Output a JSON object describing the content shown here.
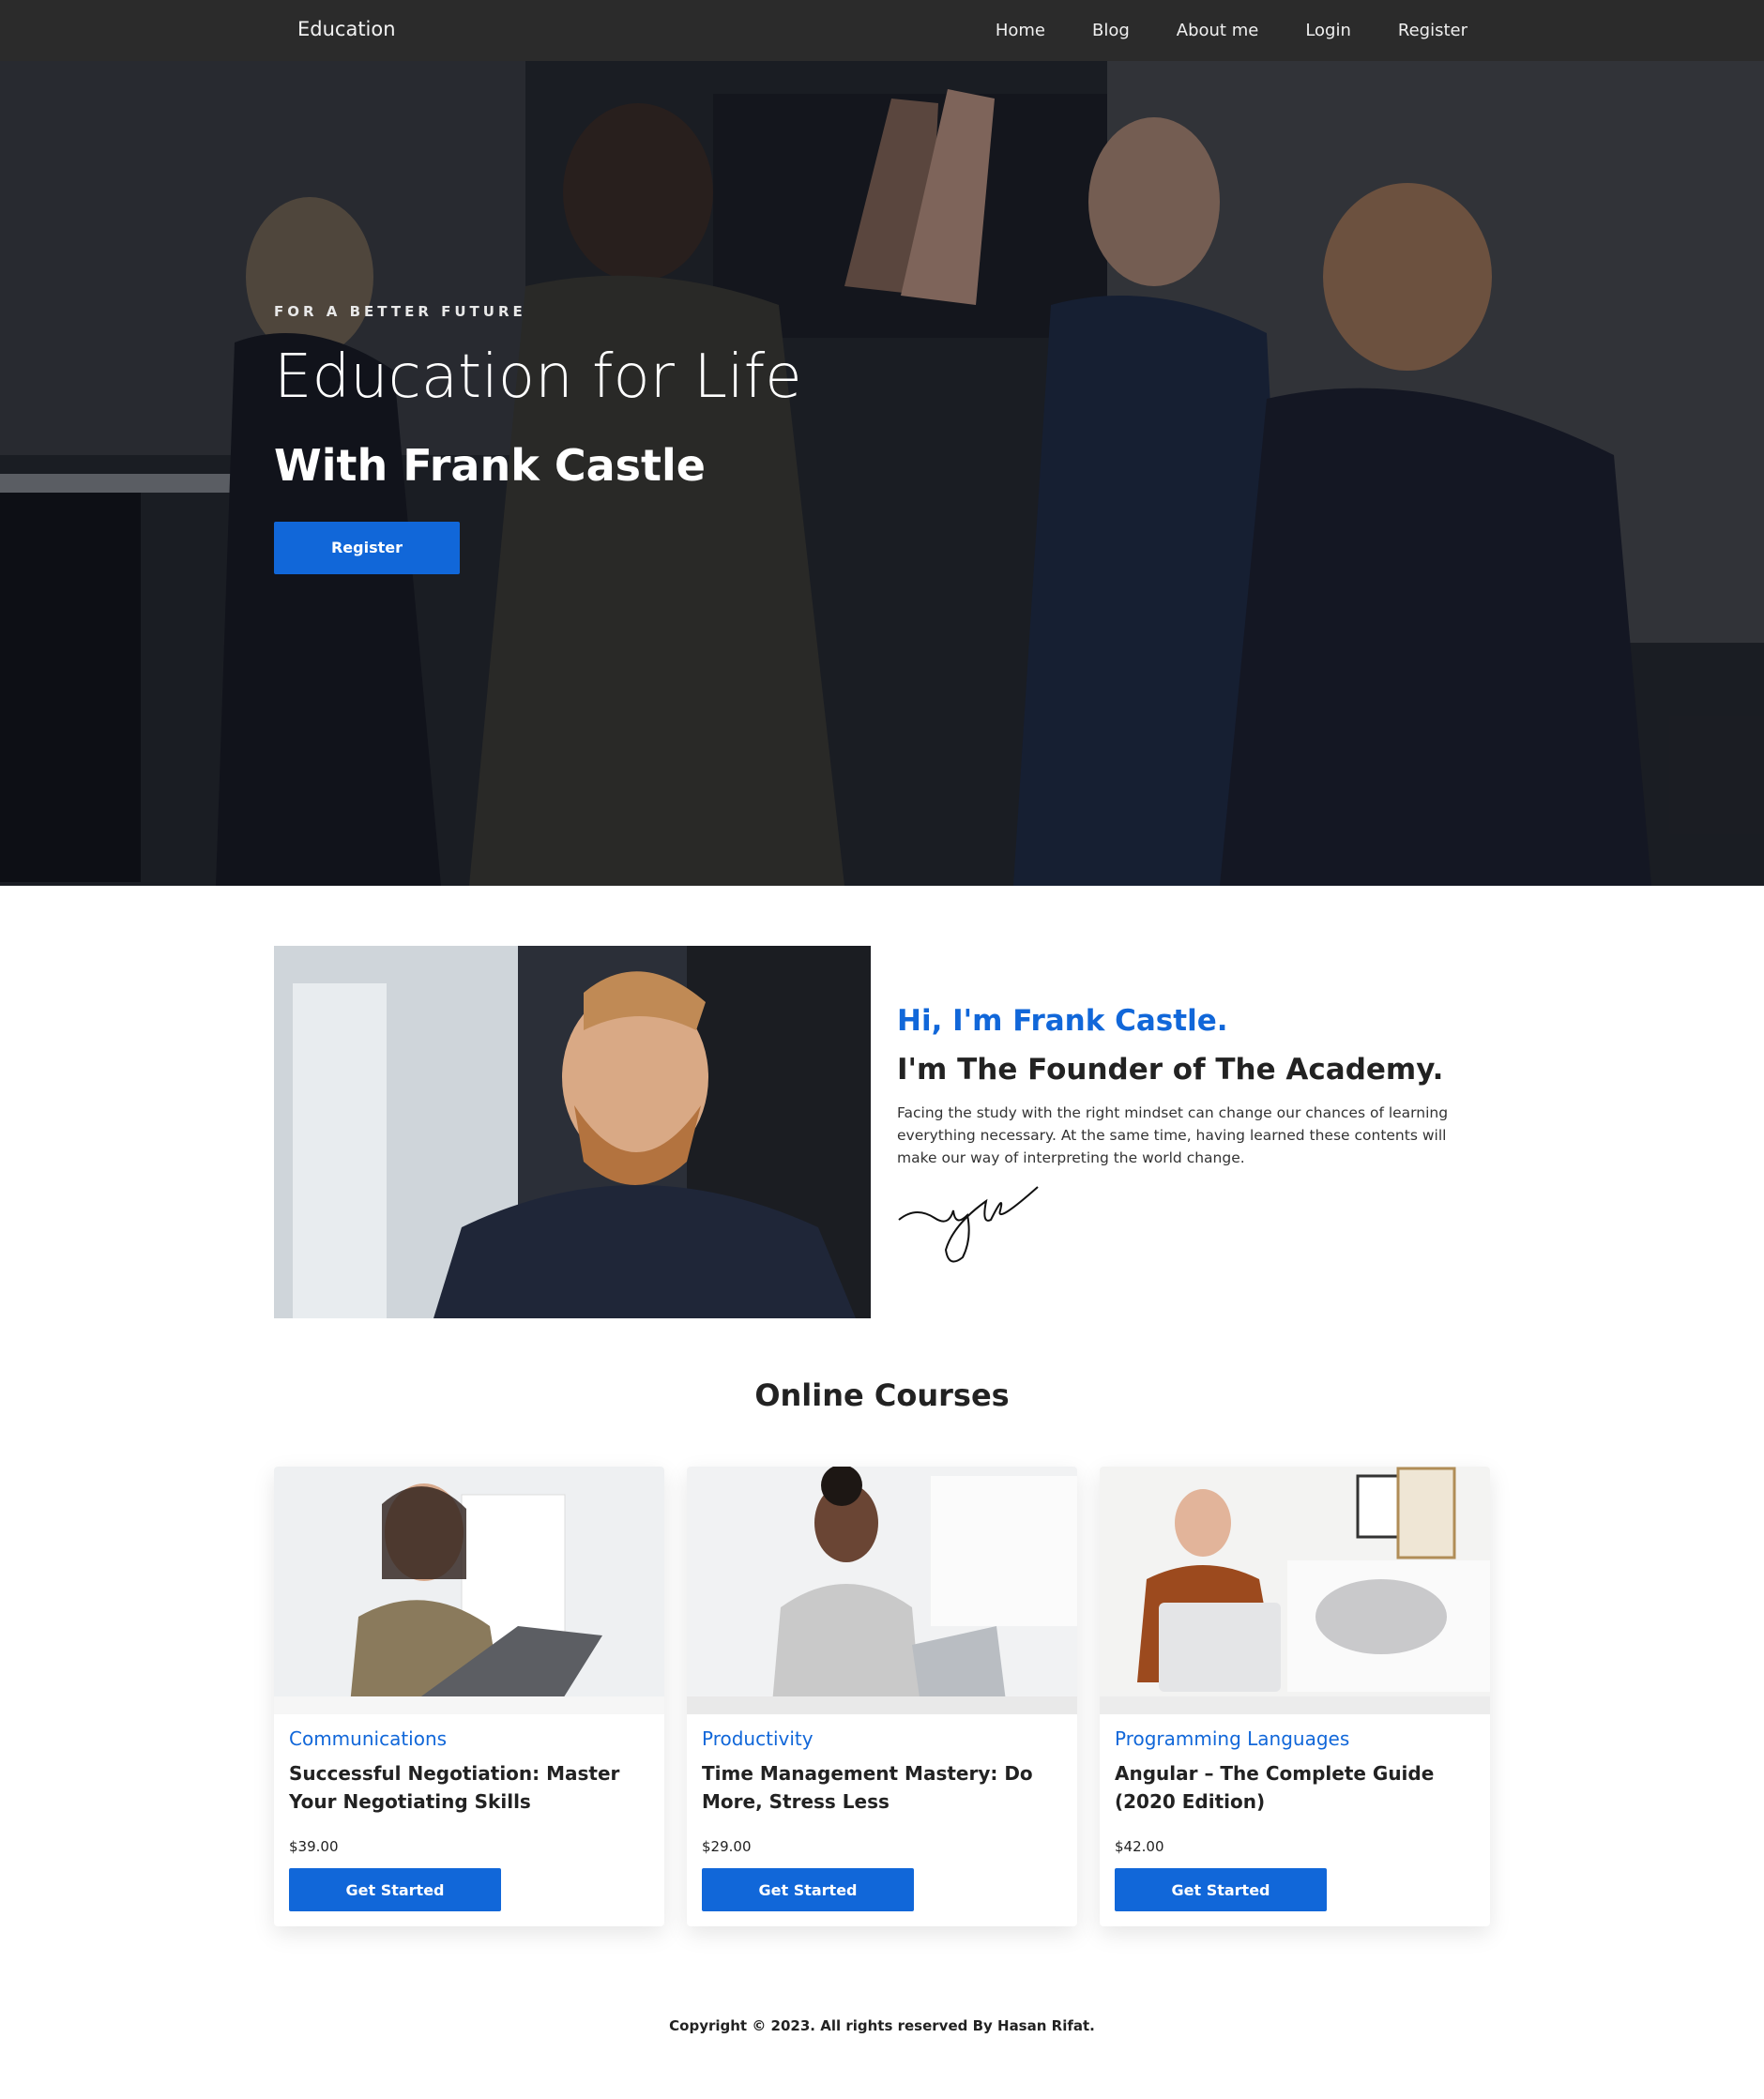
{
  "nav": {
    "brand": "Education",
    "links": [
      "Home",
      "Blog",
      "About me",
      "Login",
      "Register"
    ]
  },
  "hero": {
    "eyebrow": "FOR A BETTER FUTURE",
    "title": "Education for Life",
    "subtitle": "With Frank Castle",
    "button": "Register"
  },
  "about": {
    "greeting": "Hi, I'm Frank Castle.",
    "headline": "I'm The Founder of The Academy.",
    "body": "Facing the study with the right mindset can change our chances of learning everything necessary. At the same time, having learned these contents will make our way of interpreting the world change."
  },
  "courses": {
    "title": "Online Courses",
    "items": [
      {
        "category": "Communications",
        "title": "Successful Negotiation: Master Your Negotiating Skills",
        "price": "$39.00",
        "button": "Get Started"
      },
      {
        "category": "Productivity",
        "title": "Time Management Mastery: Do More, Stress Less",
        "price": "$29.00",
        "button": "Get Started"
      },
      {
        "category": "Programming Languages",
        "title": "Angular – The Complete Guide (2020 Edition)",
        "price": "$42.00",
        "button": "Get Started"
      }
    ]
  },
  "footer": {
    "text": "Copyright © 2023. All rights reserved By Hasan Rifat."
  },
  "colors": {
    "accent": "#1167d9",
    "navbar": "#2b2b2b"
  }
}
